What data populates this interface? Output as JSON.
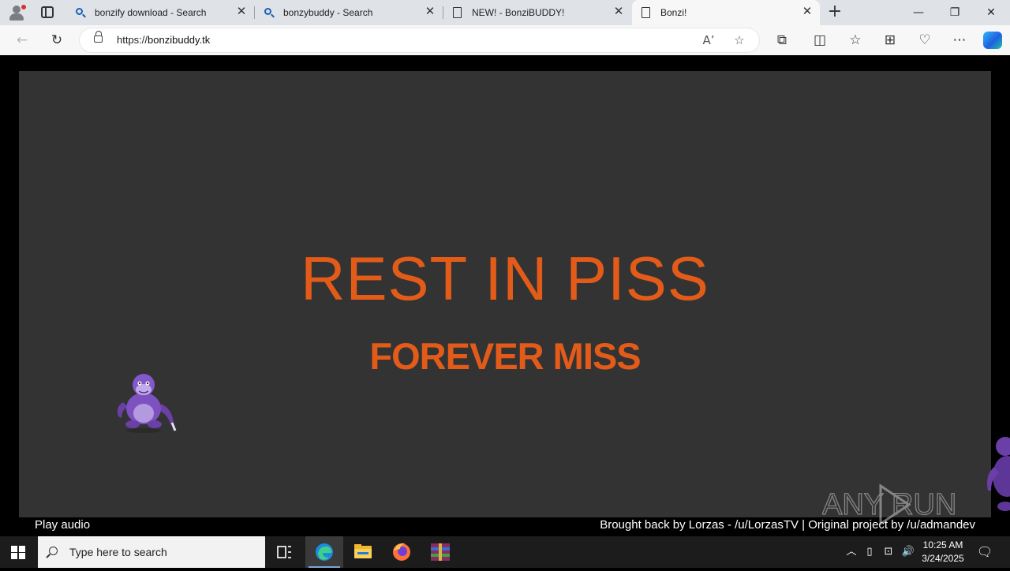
{
  "browser": {
    "tabs": [
      {
        "title": "bonzify download - Search",
        "icon": "search-icon"
      },
      {
        "title": "bonzybuddy - Search",
        "icon": "search-icon"
      },
      {
        "title": "NEW! - BonziBUDDY!",
        "icon": "page-icon"
      },
      {
        "title": "Bonzi!",
        "icon": "page-icon",
        "active": true
      }
    ],
    "new_tab": "+",
    "url_prefix": "https://",
    "url_host": "bonzibuddy.tk"
  },
  "page": {
    "headline": "REST IN PISS",
    "subheadline": "FOREVER MISS",
    "play_audio": "Play audio",
    "credits": "Brought back by Lorzas - /u/LorzasTV | Original project by /u/admandev",
    "background": "#333333",
    "accent": "#e35b19"
  },
  "watermark": "ANY RUN",
  "taskbar": {
    "search_placeholder": "Type here to search",
    "time": "10:25 AM",
    "date": "3/24/2025"
  }
}
